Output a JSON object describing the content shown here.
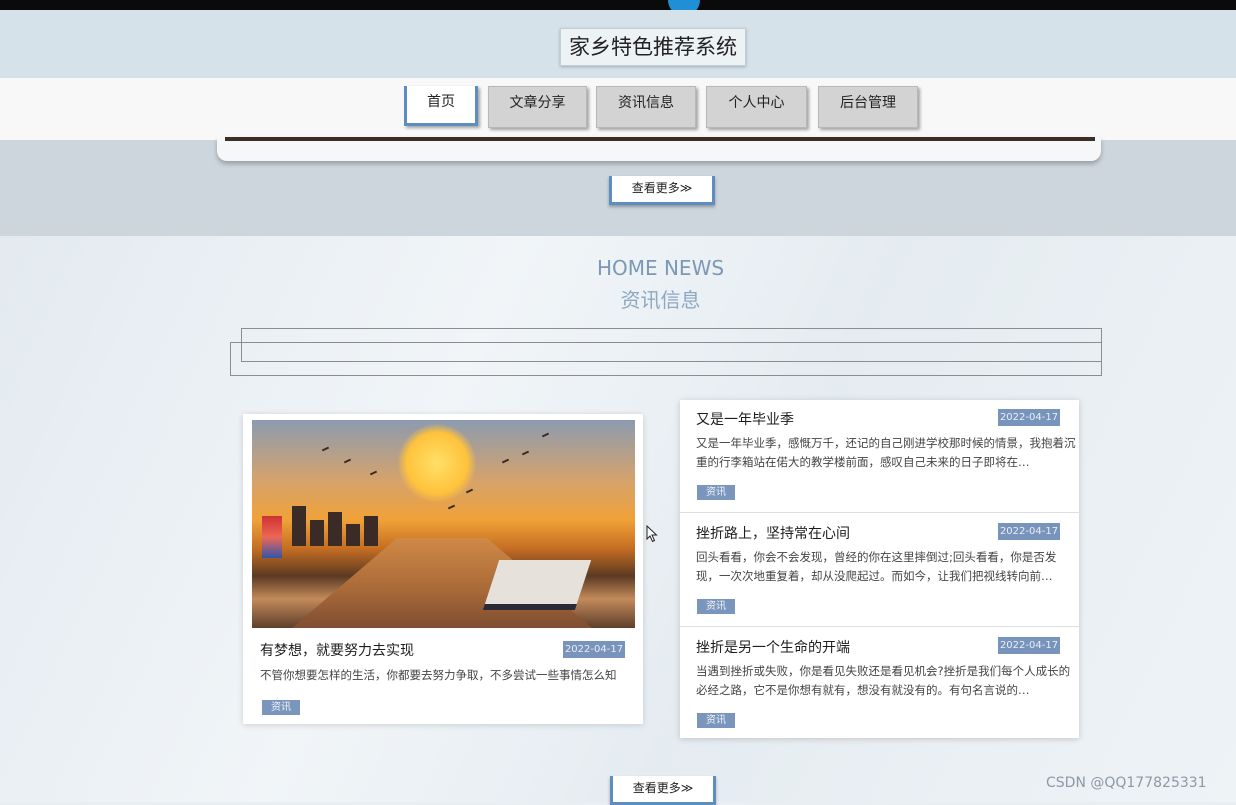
{
  "site": {
    "title": "家乡特色推荐系统"
  },
  "nav": {
    "items": [
      {
        "label": "首页"
      },
      {
        "label": "文章分享"
      },
      {
        "label": "资讯信息"
      },
      {
        "label": "个人中心"
      },
      {
        "label": "后台管理"
      }
    ]
  },
  "banner": {
    "more_label": "查看更多≫"
  },
  "news": {
    "heading_en": "HOME NEWS",
    "heading_cn": "资讯信息",
    "featured": {
      "title": "有梦想，就要努力去实现",
      "date": "2022-04-17",
      "desc": "不管你想要怎样的生活，你都要去努力争取，不多尝试一些事情怎么知",
      "tag": "资讯"
    },
    "list": [
      {
        "title": "又是一年毕业季",
        "date": "2022-04-17",
        "desc": "又是一年毕业季，感慨万千，还记的自己刚进学校那时候的情景，我抱着沉重的行李箱站在偌大的教学楼前面，感叹自己未来的日子即将在…",
        "tag": "资讯"
      },
      {
        "title": "挫折路上，坚持常在心间",
        "date": "2022-04-17",
        "desc": "回头看看，你会不会发现，曾经的你在这里摔倒过;回头看看，你是否发现，一次次地重复着，却从没爬起过。而如今，让我们把视线转向前…",
        "tag": "资讯"
      },
      {
        "title": "挫折是另一个生命的开端",
        "date": "2022-04-17",
        "desc": "当遇到挫折或失败，你是看见失败还是看见机会?挫折是我们每个人成长的必经之路，它不是你想有就有，想没有就没有的。有句名言说的…",
        "tag": "资讯"
      }
    ],
    "more_label": "查看更多≫"
  },
  "watermark": "CSDN @QQ177825331"
}
